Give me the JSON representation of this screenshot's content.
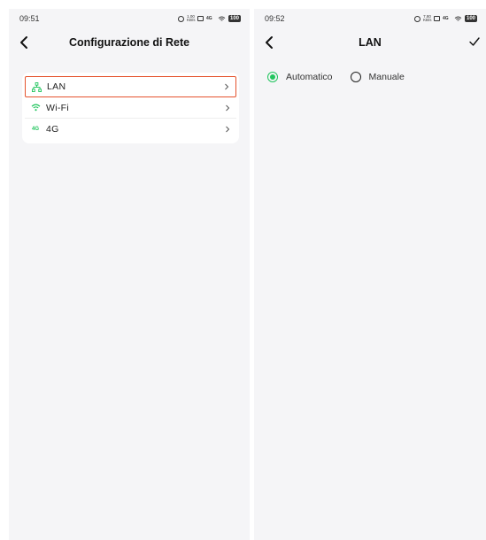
{
  "left_screen": {
    "status_time": "09:51",
    "status_speed": "1.00 KB/s",
    "status_battery": "100",
    "status_net": "4G",
    "title": "Configurazione di Rete",
    "items": [
      {
        "label": "LAN",
        "icon": "lan-icon",
        "selected": true
      },
      {
        "label": "Wi-Fi",
        "icon": "wifi-icon",
        "selected": false
      },
      {
        "label": "4G",
        "icon": "4g-icon",
        "icon_text": "4G",
        "selected": false
      }
    ]
  },
  "right_screen": {
    "status_time": "09:52",
    "status_speed": "7.80 KB/s",
    "status_battery": "100",
    "status_net": "4G",
    "title": "LAN",
    "options": [
      {
        "label": "Automatico",
        "checked": true
      },
      {
        "label": "Manuale",
        "checked": false
      }
    ]
  },
  "colors": {
    "accent": "#22c55e",
    "selection_border": "#e5532e",
    "background": "#f5f5f7"
  }
}
